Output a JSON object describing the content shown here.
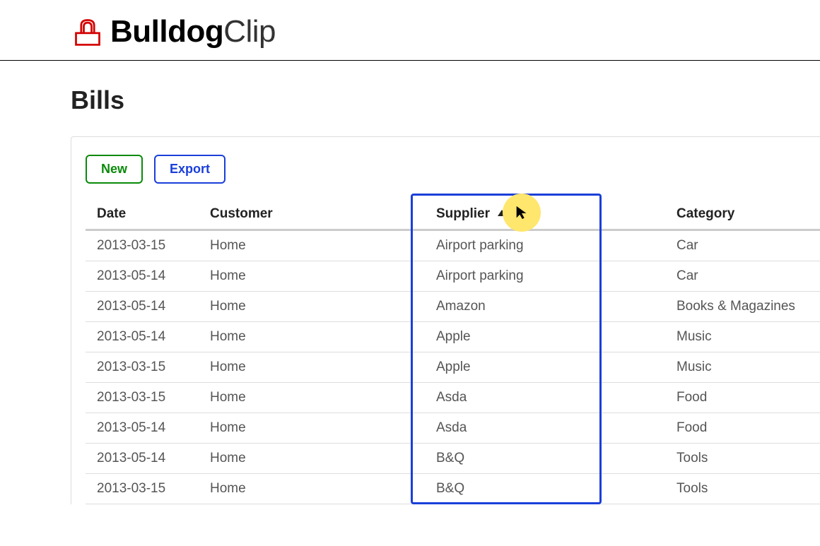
{
  "brand": {
    "bold": "Bulldog",
    "light": "Clip"
  },
  "page_title": "Bills",
  "toolbar": {
    "new_label": "New",
    "export_label": "Export"
  },
  "columns": {
    "date": "Date",
    "customer": "Customer",
    "supplier": "Supplier",
    "category": "Category"
  },
  "sort": {
    "column": "supplier",
    "direction": "asc"
  },
  "rows": [
    {
      "date": "2013-03-15",
      "customer": "Home",
      "supplier": "Airport parking",
      "category": "Car"
    },
    {
      "date": "2013-05-14",
      "customer": "Home",
      "supplier": "Airport parking",
      "category": "Car"
    },
    {
      "date": "2013-05-14",
      "customer": "Home",
      "supplier": "Amazon",
      "category": "Books & Magazines"
    },
    {
      "date": "2013-05-14",
      "customer": "Home",
      "supplier": "Apple",
      "category": "Music"
    },
    {
      "date": "2013-03-15",
      "customer": "Home",
      "supplier": "Apple",
      "category": "Music"
    },
    {
      "date": "2013-03-15",
      "customer": "Home",
      "supplier": "Asda",
      "category": "Food"
    },
    {
      "date": "2013-05-14",
      "customer": "Home",
      "supplier": "Asda",
      "category": "Food"
    },
    {
      "date": "2013-05-14",
      "customer": "Home",
      "supplier": "B&Q",
      "category": "Tools"
    },
    {
      "date": "2013-03-15",
      "customer": "Home",
      "supplier": "B&Q",
      "category": "Tools"
    }
  ]
}
